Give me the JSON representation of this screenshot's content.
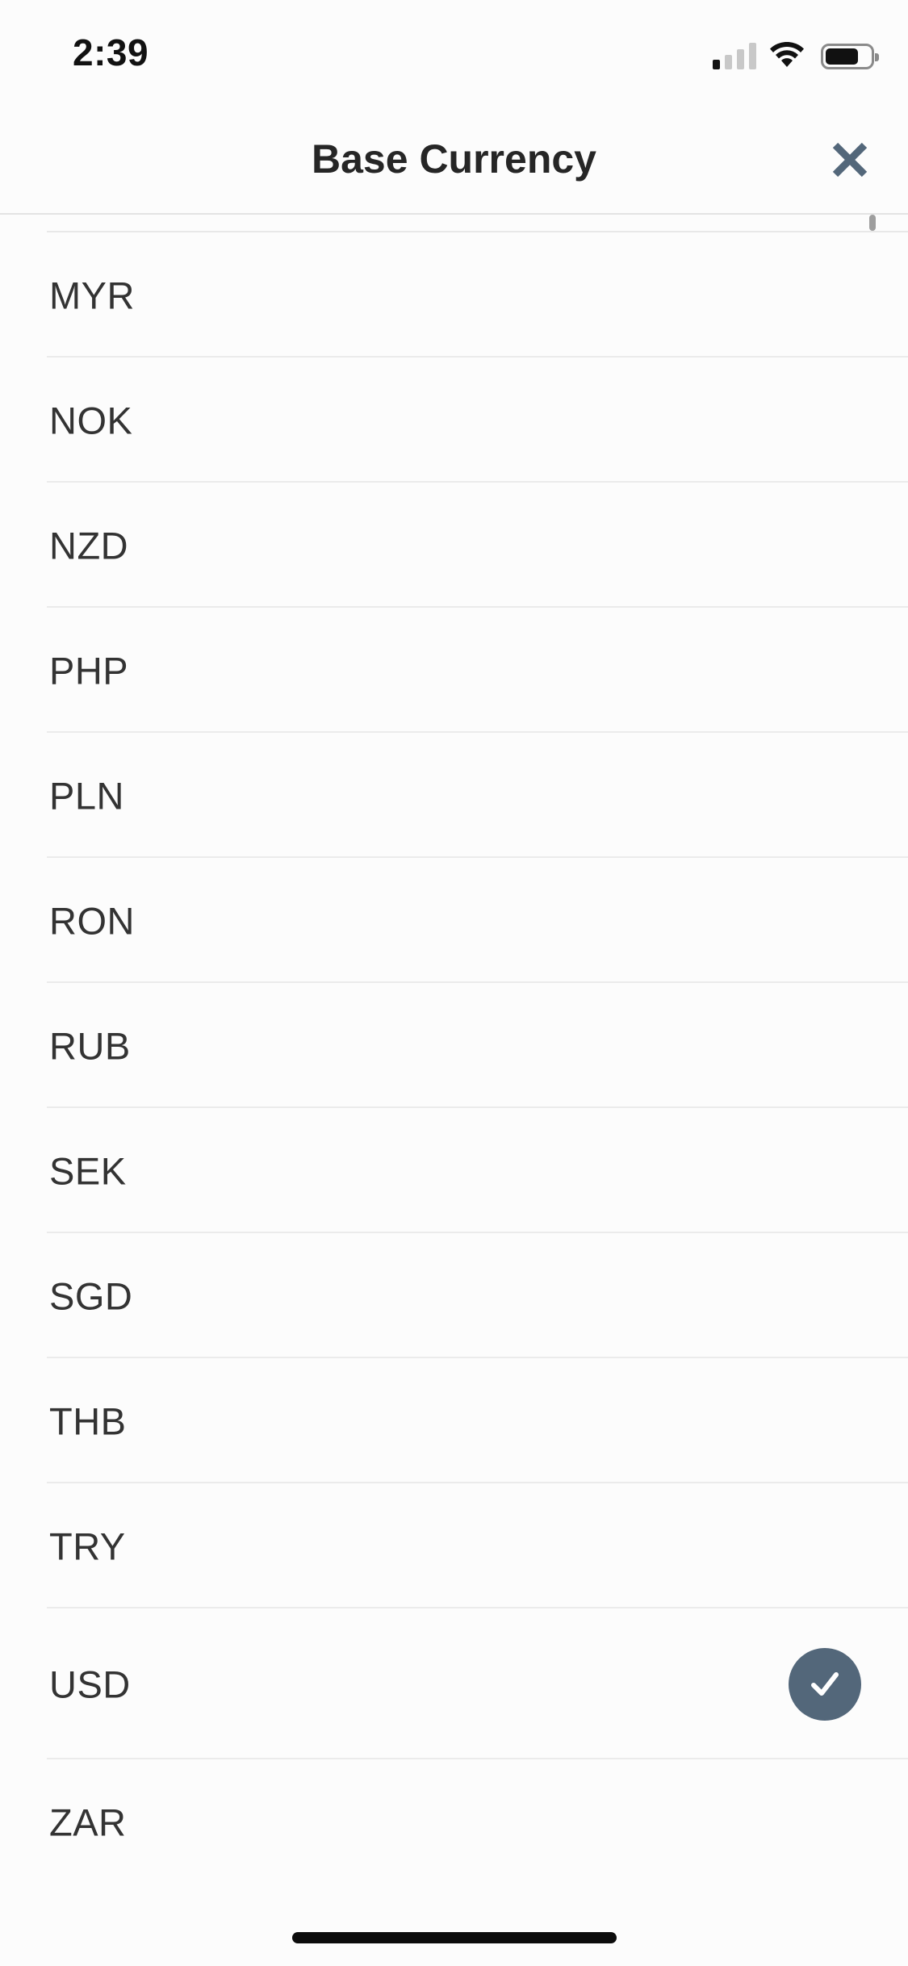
{
  "status_bar": {
    "time": "2:39",
    "signal_bars_active": 1,
    "signal_bars_total": 4,
    "battery_level": 0.74
  },
  "header": {
    "title": "Base Currency",
    "close_icon": "close-icon"
  },
  "colors": {
    "accent": "#53677a",
    "background": "#fcfcfc",
    "divider": "#ebebeb"
  },
  "currencies": [
    {
      "code": "MYR",
      "selected": false
    },
    {
      "code": "NOK",
      "selected": false
    },
    {
      "code": "NZD",
      "selected": false
    },
    {
      "code": "PHP",
      "selected": false
    },
    {
      "code": "PLN",
      "selected": false
    },
    {
      "code": "RON",
      "selected": false
    },
    {
      "code": "RUB",
      "selected": false
    },
    {
      "code": "SEK",
      "selected": false
    },
    {
      "code": "SGD",
      "selected": false
    },
    {
      "code": "THB",
      "selected": false
    },
    {
      "code": "TRY",
      "selected": false
    },
    {
      "code": "USD",
      "selected": true
    },
    {
      "code": "ZAR",
      "selected": false
    }
  ]
}
